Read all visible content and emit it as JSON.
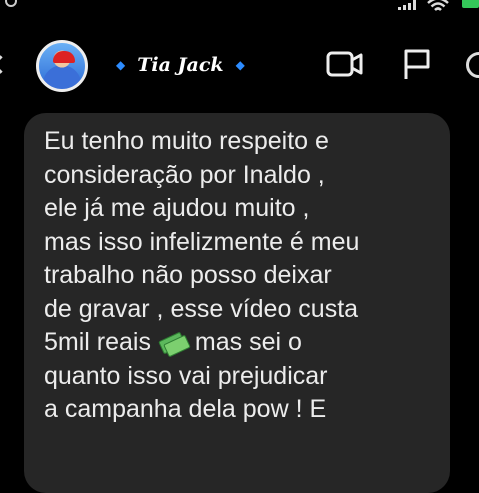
{
  "status_bar": {
    "battery_color": "#34c759"
  },
  "header": {
    "contact_name": "Tia Jack",
    "name_decoration_color": "#2d8cff",
    "icons": [
      "back-chevron-icon",
      "avatar",
      "video-call-icon",
      "flag-icon",
      "more-icon"
    ]
  },
  "message": {
    "lines": [
      "Eu tenho muito respeito e",
      "consideração por Inaldo ,",
      "ele já me ajudou muito ,",
      "mas isso infelizmente é meu",
      "trabalho não posso deixar",
      "de gravar , esse vídeo custa",
      "5mil reais",
      "mas sei o",
      "quanto isso vai prejudicar",
      "a campanha dela pow ! E"
    ],
    "emoji": "money-with-wings-icon",
    "bubble_color": "#262626"
  }
}
